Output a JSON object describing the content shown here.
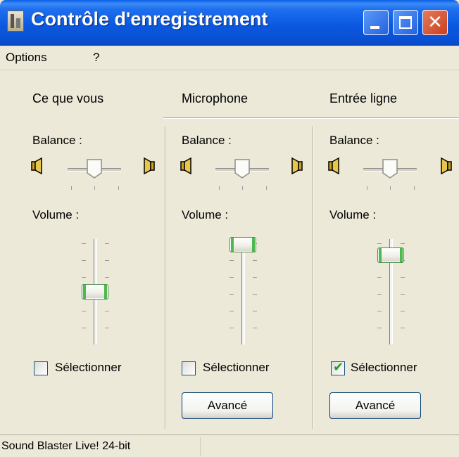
{
  "window": {
    "title": "Contrôle d'enregistrement"
  },
  "menu": [
    "Options",
    "?"
  ],
  "columns": [
    {
      "title": "Ce que vous",
      "balance_label": "Balance :",
      "volume_label": "Volume :",
      "volume_level": 0.5,
      "select_label": "Sélectionner",
      "selected": false
    },
    {
      "title": "Microphone",
      "balance_label": "Balance :",
      "volume_label": "Volume :",
      "volume_level": 0.95,
      "select_label": "Sélectionner",
      "selected": false,
      "advanced_label": "Avancé"
    },
    {
      "title": "Entrée ligne",
      "balance_label": "Balance :",
      "volume_label": "Volume :",
      "volume_level": 0.85,
      "select_label": "Sélectionner",
      "selected": true,
      "advanced_label": "Avancé"
    }
  ],
  "status": {
    "text": "Sound Blaster Live! 24-bit"
  },
  "colors": {
    "titlebar": "#0a59e0",
    "face": "#ece9d8",
    "thumb_accent": "#4fb84f",
    "check": "#21a121"
  },
  "icons": {
    "window": "mixer-icon",
    "balance_left": "speaker-left-icon",
    "balance_right": "speaker-right-icon"
  }
}
